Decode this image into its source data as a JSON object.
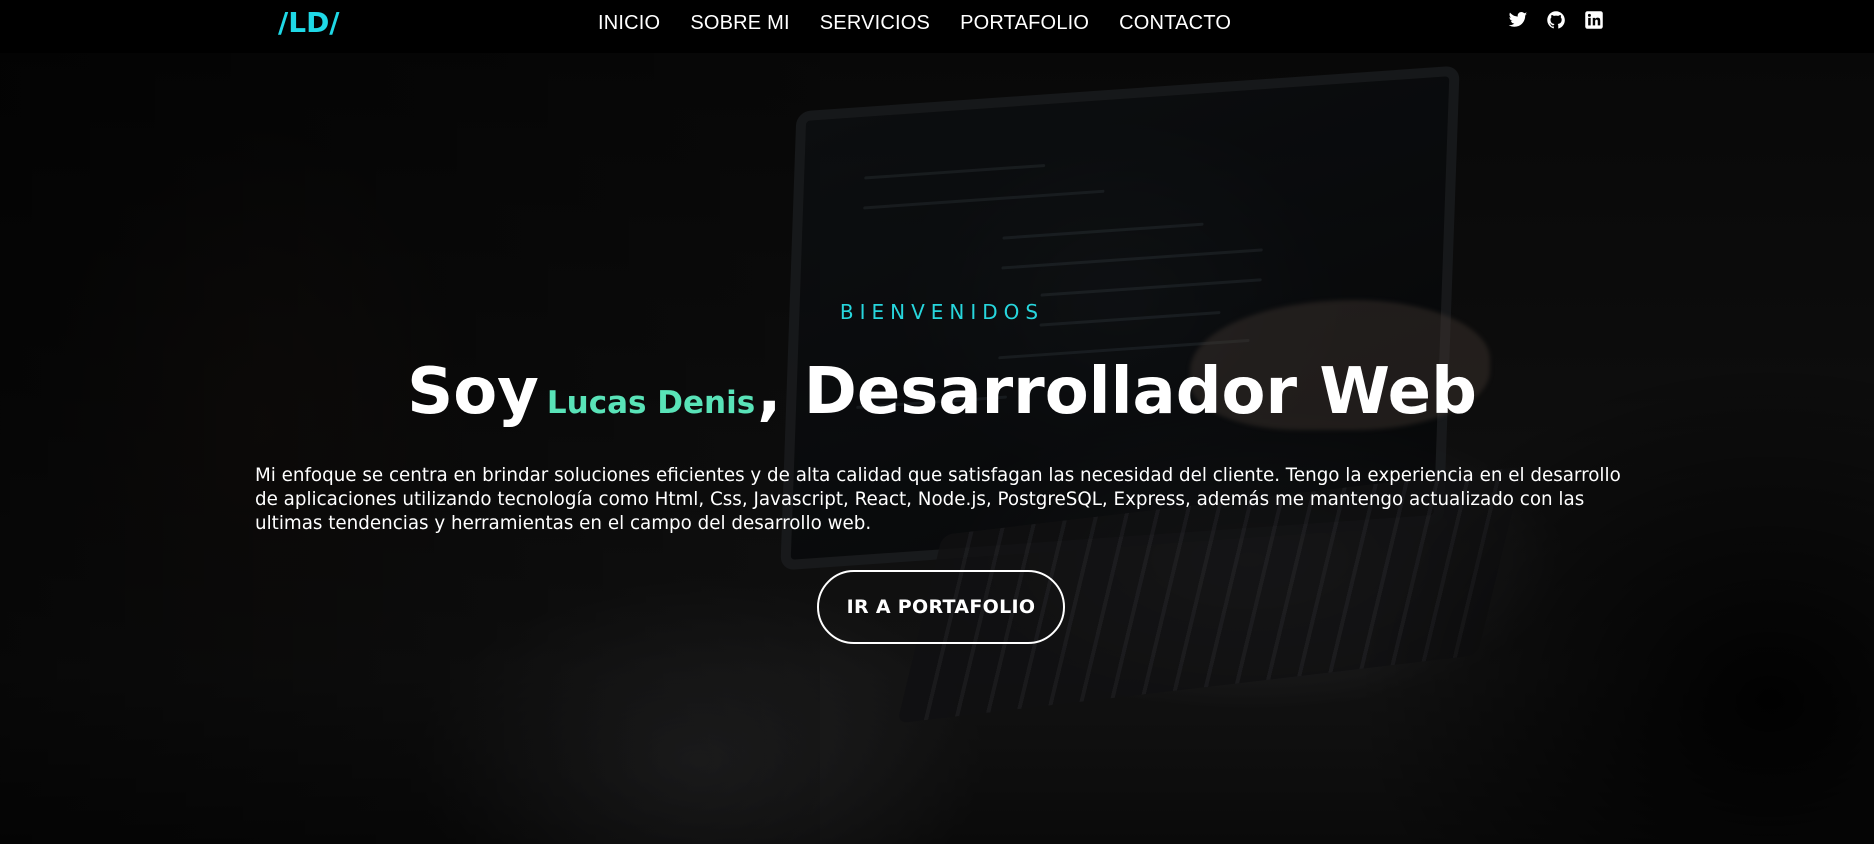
{
  "brand": {
    "logo": "/LD/",
    "accent_color": "#1fd8e6"
  },
  "nav": {
    "items": [
      {
        "label": "INICIO"
      },
      {
        "label": "SOBRE MI"
      },
      {
        "label": "SERVICIOS"
      },
      {
        "label": "PORTAFOLIO"
      },
      {
        "label": "CONTACTO"
      }
    ]
  },
  "social": {
    "icons": [
      "twitter-icon",
      "github-icon",
      "linkedin-icon"
    ]
  },
  "hero": {
    "eyebrow": "BIENVENIDOS",
    "headline_prefix": "Soy",
    "name": "Lucas Denis",
    "headline_suffix": ", Desarrollador Web",
    "name_color": "#59e3b8",
    "description": "Mi enfoque se centra en brindar soluciones eficientes y de alta calidad que satisfagan las necesidad del cliente. Tengo la experiencia en el desarrollo de aplicaciones utilizando tecnología como Html, Css, Javascript, React, Node.js, PostgreSQL, Express, además me mantengo actualizado con las ultimas tendencias y herramientas en el campo del desarrollo web.",
    "cta_label": "IR A PORTAFOLIO"
  }
}
